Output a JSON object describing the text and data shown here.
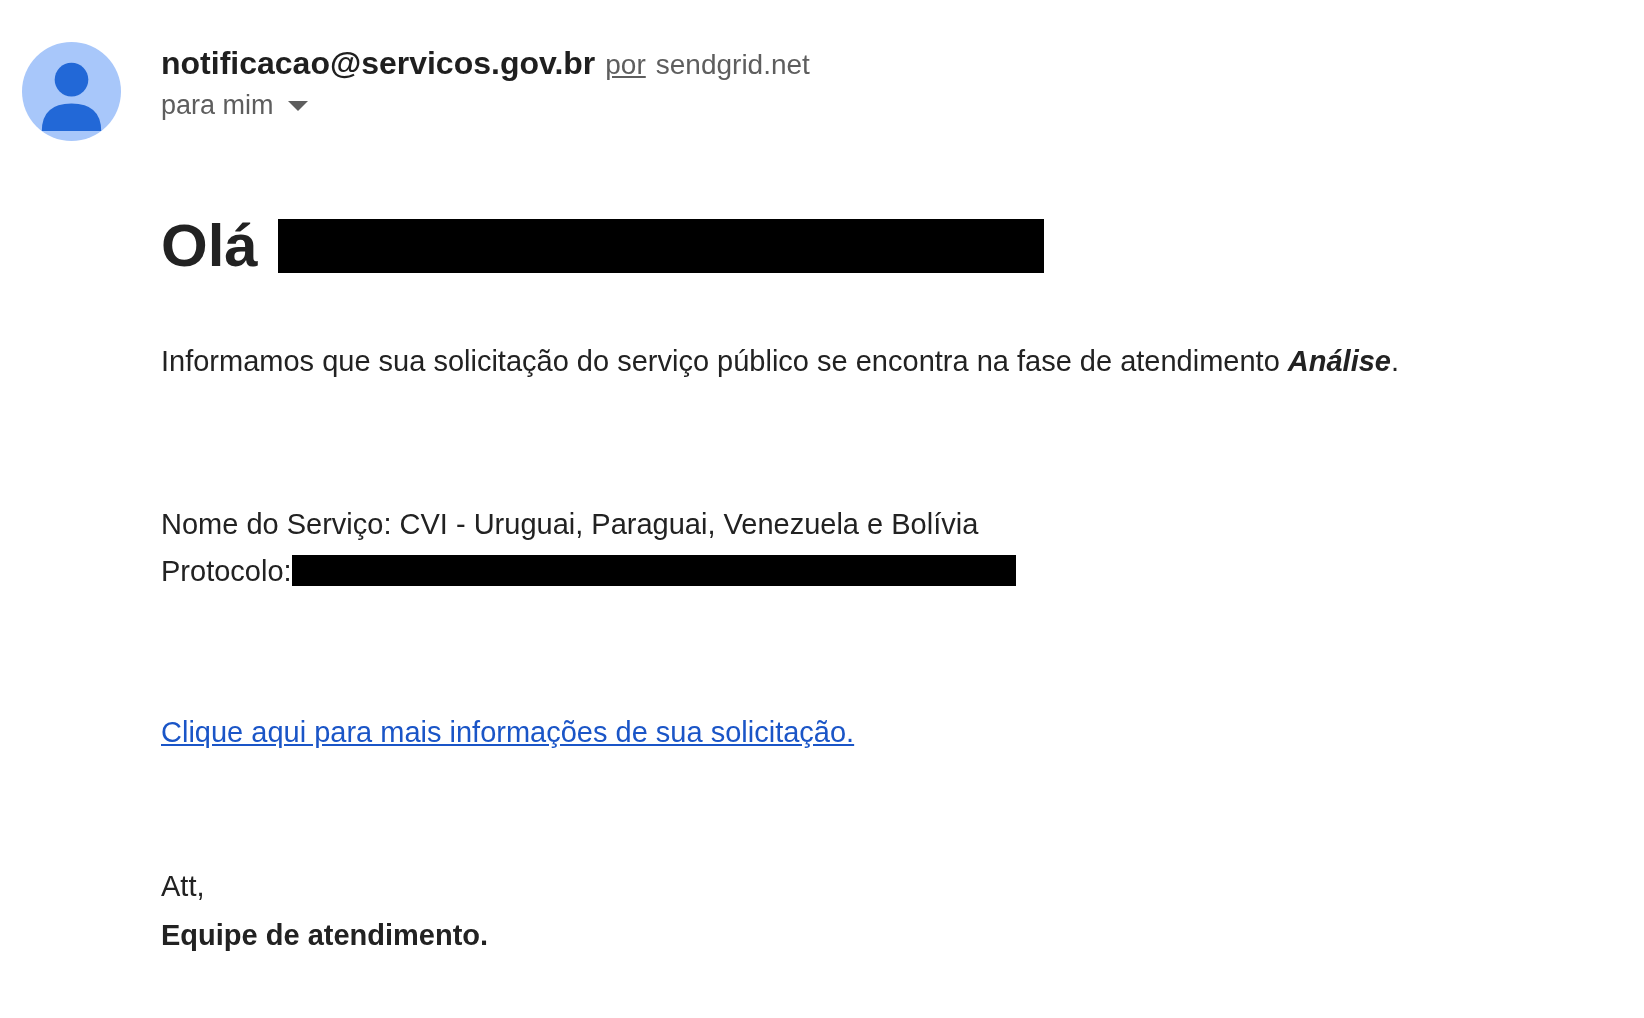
{
  "sender": {
    "email": "notificacao@servicos.gov.br",
    "via_label": "por",
    "via_domain": "sendgrid.net",
    "recipient": "para mim"
  },
  "body": {
    "greeting": "Olá",
    "intro": "Informamos que sua solicitação do serviço público se encontra na fase de atendimento **Análise**.",
    "service": "Nome do Serviço: CVI - Uruguai, Paraguai, Venezuela e Bolívia",
    "protocol_label": "Protocolo:",
    "link": "Clique aqui para mais informações de sua solicitação.",
    "closing": "Att,",
    "signature": "Equipe de atendimento."
  }
}
